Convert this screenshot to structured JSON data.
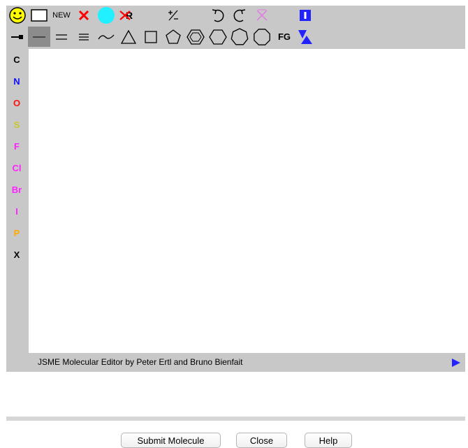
{
  "toolbar": {
    "new_label": "NEW",
    "fg_label": "FG",
    "row1_tools": [
      "smiley-icon",
      "rectangle-select-icon",
      "new-button",
      "delete-x-icon",
      "charge-circle-icon",
      "delete-r-group-icon",
      "charge-plus-minus-icon",
      "undo-icon",
      "redo-icon",
      "template-x-icon",
      "mark-icon",
      "inverse-direction-icon"
    ],
    "row2_tools": [
      "end-bond-icon",
      "single-bond-icon",
      "double-bond-icon",
      "triple-bond-icon",
      "chain-icon",
      "triangle-ring-icon",
      "square-ring-icon",
      "pentagon-ring-icon",
      "benzene-ring-icon",
      "hexagon-ring-icon",
      "heptagon-ring-icon",
      "octagon-ring-icon",
      "functional-group-button",
      "rotate-direction-icon"
    ]
  },
  "atoms": [
    {
      "symbol": "C",
      "color": "#000000"
    },
    {
      "symbol": "N",
      "color": "#1010ff"
    },
    {
      "symbol": "O",
      "color": "#ff1010"
    },
    {
      "symbol": "S",
      "color": "#c8c832"
    },
    {
      "symbol": "F",
      "color": "#ff22ff"
    },
    {
      "symbol": "Cl",
      "color": "#ff22ff"
    },
    {
      "symbol": "Br",
      "color": "#ff22ff"
    },
    {
      "symbol": "I",
      "color": "#ff22ff"
    },
    {
      "symbol": "P",
      "color": "#ffaa00"
    },
    {
      "symbol": "X",
      "color": "#000000"
    }
  ],
  "status": {
    "text": "JSME Molecular Editor by Peter Ertl and Bruno Bienfait"
  },
  "buttons": {
    "submit": "Submit Molecule",
    "close": "Close",
    "help": "Help"
  },
  "colors": {
    "accent_blue": "#2222ff",
    "selected_bg": "#8c8c8c",
    "toolbar_bg": "#c8c8c8",
    "smiley": "#ffff00",
    "charge_circle": "#20f0ff",
    "delete_red": "#ff0000"
  }
}
